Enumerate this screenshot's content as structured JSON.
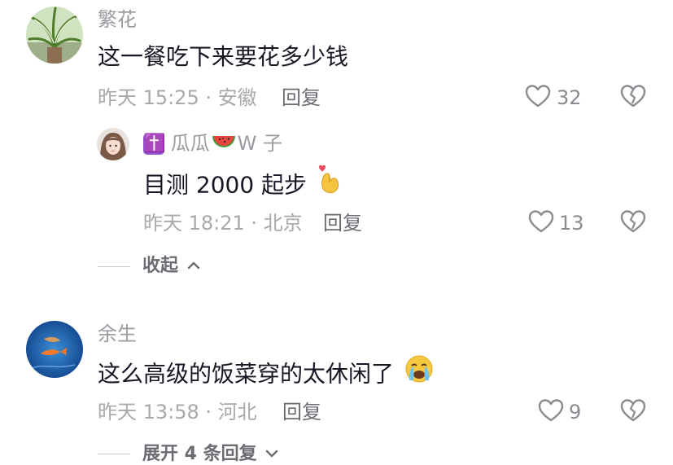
{
  "comments": [
    {
      "name": "繁花",
      "content": "这一餐吃下来要花多少钱",
      "time_location": "昨天 15:25 · 安徽",
      "reply_label": "回复",
      "likes": "32",
      "replies": [
        {
          "name_prefix": "✝️",
          "name_main": "瓜瓜",
          "name_suffix": "W 子",
          "content": "目测 2000 起步",
          "time_location": "昨天 18:21 · 北京",
          "reply_label": "回复",
          "likes": "13"
        }
      ],
      "toggle_label": "收起"
    },
    {
      "name": "余生",
      "content": "这么高级的饭菜穿的太休闲了",
      "time_location": "昨天 13:58 · 河北",
      "reply_label": "回复",
      "likes": "9",
      "toggle_label": "展开 4 条回复"
    }
  ],
  "colors": {
    "text_primary": "#161823",
    "text_secondary": "#9b9ba1",
    "badge_purple": "#8e5bd1"
  },
  "icons": {
    "like": "heart-outline-icon",
    "dislike": "broken-heart-icon",
    "collapse": "chevron-up-icon",
    "expand": "chevron-down-icon"
  }
}
